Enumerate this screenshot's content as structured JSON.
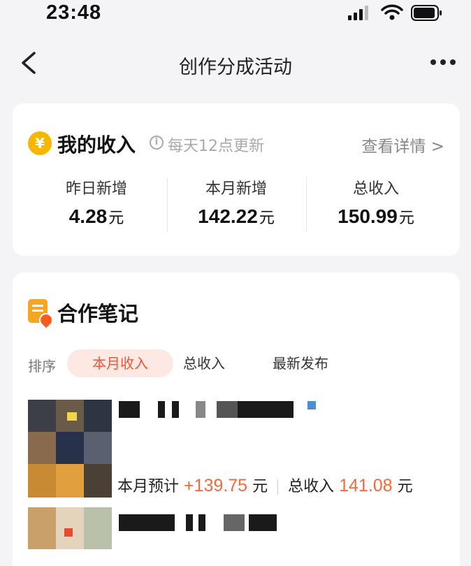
{
  "status_bar": {
    "time": "23:48"
  },
  "nav": {
    "title": "创作分成活动"
  },
  "income": {
    "title": "我的收入",
    "update_note": "每天12点更新",
    "details_link": "查看详情 >",
    "coin_symbol": "¥",
    "unit": "元",
    "stats": [
      {
        "label": "昨日新增",
        "value": "4.28"
      },
      {
        "label": "本月新增",
        "value": "142.22"
      },
      {
        "label": "总收入",
        "value": "150.99"
      }
    ]
  },
  "notes": {
    "title": "合作笔记",
    "sort_label": "排序",
    "tabs": [
      "本月收入",
      "总收入",
      "最新发布"
    ],
    "items": [
      {
        "month_label": "本月预计",
        "month_value": "+139.75",
        "unit": "元",
        "total_label": "总收入",
        "total_value": "141.08"
      }
    ]
  },
  "colors": {
    "accent": "#f56a3a",
    "coin": "#f5b700",
    "note_icon": "#f5a623"
  },
  "icons": [
    "signal-icon",
    "wifi-icon",
    "battery-icon",
    "back-chevron-icon",
    "more-icon",
    "coin-icon",
    "info-icon",
    "note-fire-icon"
  ]
}
